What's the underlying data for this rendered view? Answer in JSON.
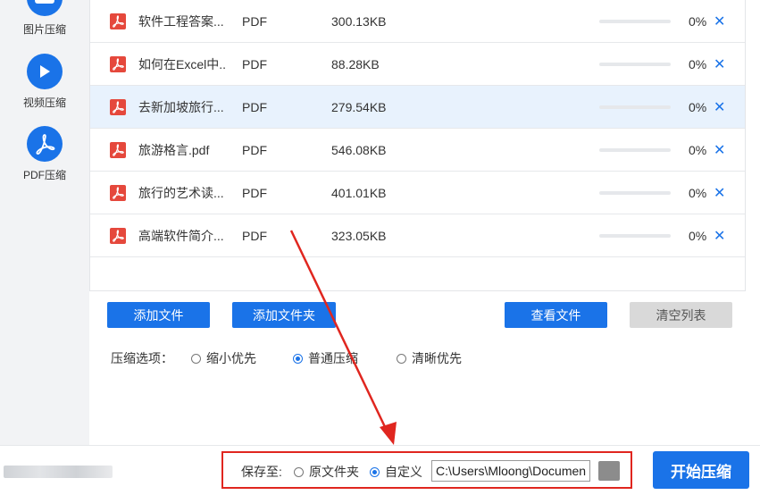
{
  "sidebar": {
    "items": [
      {
        "label": "图片压缩",
        "icon": "image-cloud-icon"
      },
      {
        "label": "视频压缩",
        "icon": "play-icon"
      },
      {
        "label": "PDF压缩",
        "icon": "pdf-icon"
      }
    ]
  },
  "files": [
    {
      "name": "软件工程答案...",
      "type": "PDF",
      "size": "300.13KB",
      "progress": "0%"
    },
    {
      "name": "如何在Excel中..",
      "type": "PDF",
      "size": "88.28KB",
      "progress": "0%"
    },
    {
      "name": "去新加坡旅行...",
      "type": "PDF",
      "size": "279.54KB",
      "progress": "0%"
    },
    {
      "name": "旅游格言.pdf",
      "type": "PDF",
      "size": "546.08KB",
      "progress": "0%"
    },
    {
      "name": "旅行的艺术读...",
      "type": "PDF",
      "size": "401.01KB",
      "progress": "0%"
    },
    {
      "name": "高端软件简介...",
      "type": "PDF",
      "size": "323.05KB",
      "progress": "0%"
    }
  ],
  "toolbar": {
    "add_file": "添加文件",
    "add_folder": "添加文件夹",
    "view_file": "查看文件",
    "clear_list": "清空列表"
  },
  "compress": {
    "label": "压缩选项：",
    "options": [
      "缩小优先",
      "普通压缩",
      "清晰优先"
    ],
    "selected": "普通压缩"
  },
  "save": {
    "label": "保存至:",
    "options": [
      "原文件夹",
      "自定义"
    ],
    "selected": "自定义",
    "path": "C:\\Users\\Mloong\\Documents"
  },
  "start_label": "开始压缩",
  "colors": {
    "accent": "#1a73e8",
    "annotation": "#e0261f",
    "delete": "#1a73e8"
  }
}
